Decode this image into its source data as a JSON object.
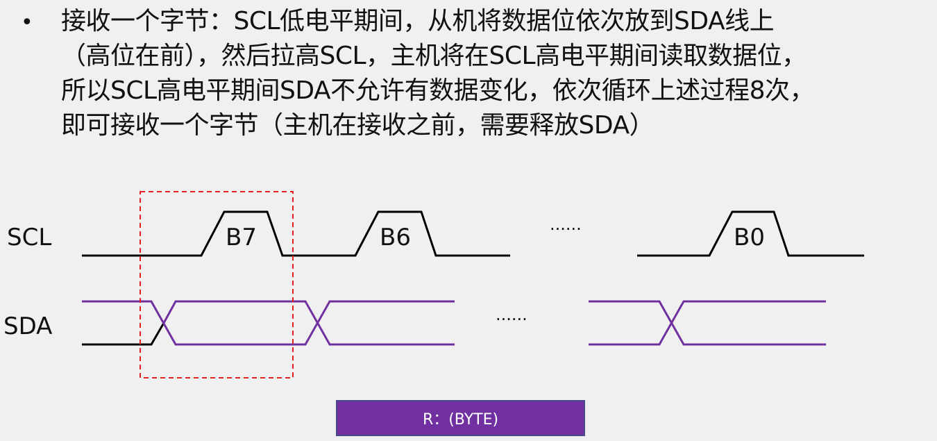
{
  "bullet": {
    "line1": "接收一个字节：SCL低电平期间，从机将数据位依次放到SDA线上",
    "line2": "（高位在前），然后拉高SCL，主机将在SCL高电平期间读取数据位，",
    "line3": "所以SCL高电平期间SDA不允许有数据变化，依次循环上述过程8次，",
    "line4": "即可接收一个字节（主机在接收之前，需要释放SDA）"
  },
  "diagram": {
    "scl_label": "SCL",
    "sda_label": "SDA",
    "bits": [
      "B7",
      "B6",
      "B0"
    ],
    "scl_ellipsis": "······",
    "sda_ellipsis": "······",
    "scl_color": "#000000",
    "sda_color": "#7030a0",
    "highlight_color": "#e02020"
  },
  "byte_box": {
    "label": "R：(BYTE)",
    "color": "#7030a0"
  }
}
